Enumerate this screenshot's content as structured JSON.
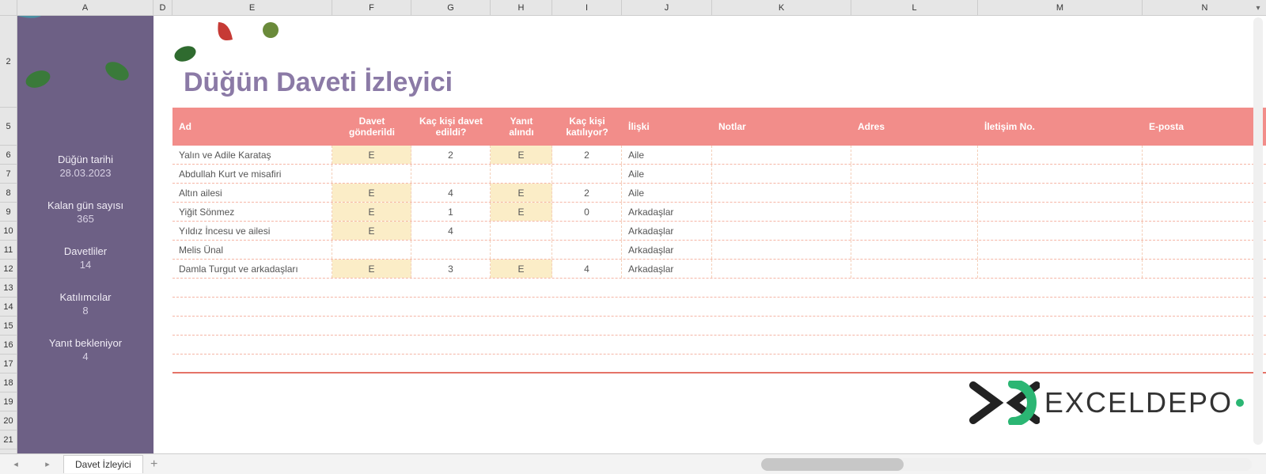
{
  "columns": {
    "A": "A",
    "D": "D",
    "E": "E",
    "F": "F",
    "G": "G",
    "H": "H",
    "I": "I",
    "J": "J",
    "K": "K",
    "L": "L",
    "M": "M",
    "N": "N"
  },
  "sidebar": {
    "items": [
      {
        "label": "Düğün tarihi",
        "value": "28.03.2023"
      },
      {
        "label": "Kalan gün sayısı",
        "value": "365"
      },
      {
        "label": "Davetliler",
        "value": "14"
      },
      {
        "label": "Katılımcılar",
        "value": "8"
      },
      {
        "label": "Yanıt bekleniyor",
        "value": "4"
      }
    ]
  },
  "title": "Düğün Daveti İzleyici",
  "headers": {
    "ad": "Ad",
    "davet": "Davet gönderildi",
    "kackisi": "Kaç kişi davet edildi?",
    "yanit": "Yanıt alındı",
    "katiliyor": "Kaç kişi katılıyor?",
    "iliski": "İlişki",
    "notlar": "Notlar",
    "adres": "Adres",
    "iletisim": "İletişim No.",
    "eposta": "E-posta"
  },
  "rows": [
    {
      "ad": "Yalın ve Adile Karataş",
      "davet": "E",
      "kackisi": "2",
      "yanit": "E",
      "katiliyor": "2",
      "iliski": "Aile"
    },
    {
      "ad": "Abdullah Kurt ve misafiri",
      "davet": "",
      "kackisi": "",
      "yanit": "",
      "katiliyor": "",
      "iliski": "Aile"
    },
    {
      "ad": "Altın ailesi",
      "davet": "E",
      "kackisi": "4",
      "yanit": "E",
      "katiliyor": "2",
      "iliski": "Aile"
    },
    {
      "ad": "Yiğit Sönmez",
      "davet": "E",
      "kackisi": "1",
      "yanit": "E",
      "katiliyor": "0",
      "iliski": "Arkadaşlar"
    },
    {
      "ad": "Yıldız İncesu ve ailesi",
      "davet": "E",
      "kackisi": "4",
      "yanit": "",
      "katiliyor": "",
      "iliski": "Arkadaşlar"
    },
    {
      "ad": "Melis Ünal",
      "davet": "",
      "kackisi": "",
      "yanit": "",
      "katiliyor": "",
      "iliski": "Arkadaşlar"
    },
    {
      "ad": "Damla Turgut ve arkadaşları",
      "davet": "E",
      "kackisi": "3",
      "yanit": "E",
      "katiliyor": "4",
      "iliski": "Arkadaşlar"
    }
  ],
  "tabs": {
    "active": "Davet İzleyici"
  },
  "logo_text": "EXCELDEPO"
}
